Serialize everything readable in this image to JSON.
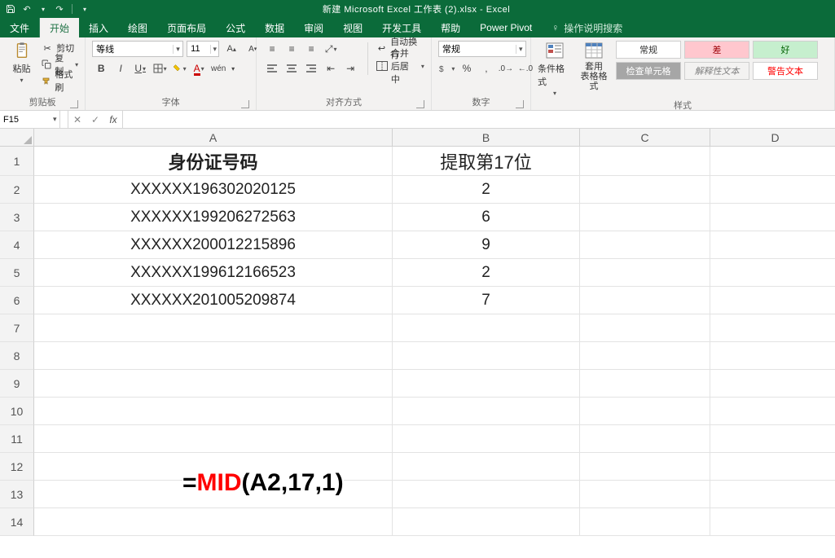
{
  "title": "新建 Microsoft Excel 工作表 (2).xlsx  -  Excel",
  "qat": {
    "save": "save-icon",
    "undo": "undo-icon",
    "redo": "redo-icon"
  },
  "tabs": {
    "file": "文件",
    "list": [
      "开始",
      "插入",
      "绘图",
      "页面布局",
      "公式",
      "数据",
      "审阅",
      "视图",
      "开发工具",
      "帮助",
      "Power Pivot"
    ],
    "active": "开始",
    "tell_me": "操作说明搜索"
  },
  "ribbon": {
    "clipboard": {
      "paste": "粘贴",
      "cut": "剪切",
      "copy": "复制",
      "format_painter": "格式刷",
      "label": "剪贴板"
    },
    "font": {
      "name": "等线",
      "size": "11",
      "bold": "B",
      "italic": "I",
      "underline": "U",
      "phonetic": "wén",
      "label": "字体"
    },
    "alignment": {
      "wrap": "自动换行",
      "merge": "合并后居中",
      "label": "对齐方式"
    },
    "number": {
      "format": "常规",
      "label": "数字"
    },
    "styles": {
      "cond_fmt": "条件格式",
      "fmt_table": "套用\n表格格式",
      "normal": "常规",
      "bad": "差",
      "good": "好",
      "check": "检查单元格",
      "explan": "解释性文本",
      "warn": "警告文本",
      "label": "样式"
    }
  },
  "namebox": "F15",
  "formula": "",
  "columns": [
    "A",
    "B",
    "C",
    "D"
  ],
  "rows": [
    1,
    2,
    3,
    4,
    5,
    6,
    7,
    8,
    9,
    10,
    11,
    12,
    13,
    14
  ],
  "table": {
    "header": {
      "A": "身份证号码",
      "B": "提取第17位"
    },
    "data": [
      {
        "A": "XXXXXX196302020125",
        "B": "2"
      },
      {
        "A": "XXXXXX199206272563",
        "B": "6"
      },
      {
        "A": "XXXXXX200012215896",
        "B": "9"
      },
      {
        "A": "XXXXXX199612166523",
        "B": "2"
      },
      {
        "A": "XXXXXX201005209874",
        "B": "7"
      }
    ]
  },
  "overlay_formula": {
    "eq": "=",
    "fn": "MID",
    "args": "(A2,17,1)"
  },
  "chart_data": {
    "type": "table",
    "title": "身份证号码 / 提取第17位",
    "columns": [
      "身份证号码",
      "提取第17位"
    ],
    "rows": [
      [
        "XXXXXX196302020125",
        2
      ],
      [
        "XXXXXX199206272563",
        6
      ],
      [
        "XXXXXX200012215896",
        9
      ],
      [
        "XXXXXX199612166523",
        2
      ],
      [
        "XXXXXX201005209874",
        7
      ]
    ],
    "formula": "=MID(A2,17,1)"
  }
}
